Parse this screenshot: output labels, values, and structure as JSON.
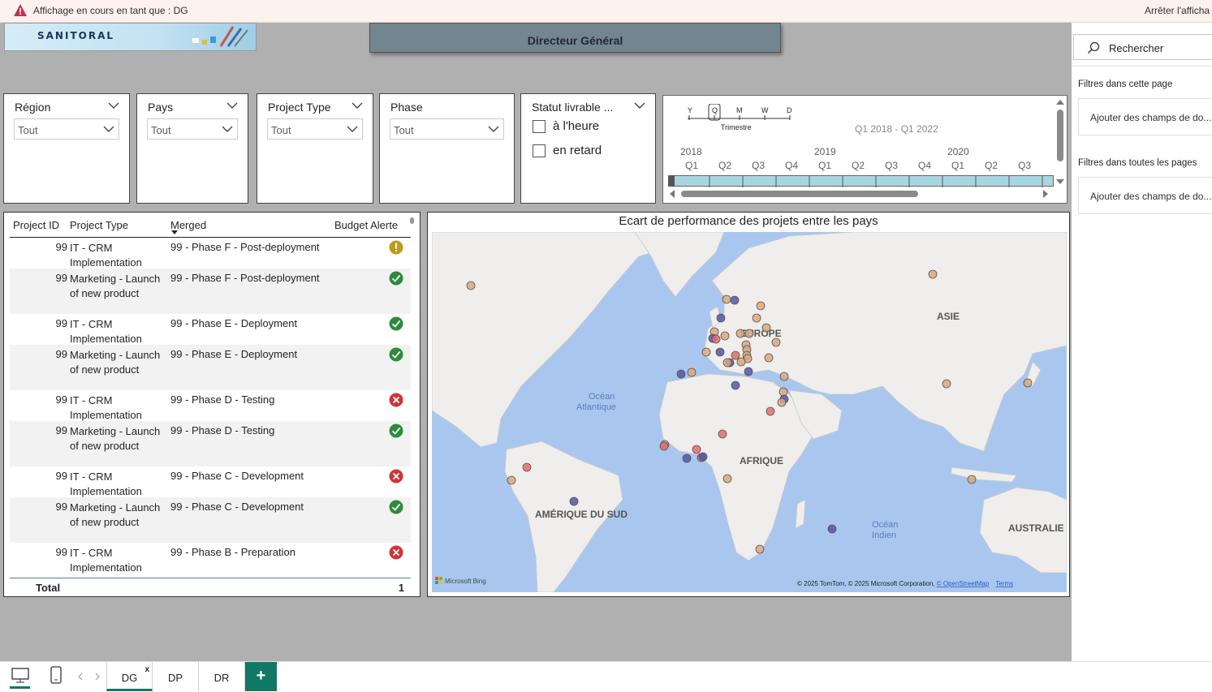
{
  "banner": {
    "viewing_as_text": "Affichage en cours en tant que : DG",
    "stop_text": "Arrêter l'afficha"
  },
  "header": {
    "logo_text": "SANITORAL",
    "title": "Directeur Général"
  },
  "slicers": {
    "region": {
      "label": "Région",
      "value": "Tout"
    },
    "pays": {
      "label": "Pays",
      "value": "Tout"
    },
    "project_type": {
      "label": "Project Type",
      "value": "Tout"
    },
    "phase": {
      "label": "Phase",
      "value": "Tout"
    },
    "statut": {
      "label": "Statut livrable ...",
      "options": [
        "à l'heure",
        "en retard"
      ]
    }
  },
  "time_slicer": {
    "granularity_options": [
      "Y",
      "Q",
      "M",
      "W",
      "D"
    ],
    "granularity_selected": "Q",
    "granularity_label": "Trimestre",
    "range_text": "Q1 2018 - Q1 2022",
    "years": [
      "2018",
      "2019",
      "2020"
    ],
    "quarters": [
      "Q1",
      "Q2",
      "Q3",
      "Q4",
      "Q1",
      "Q2",
      "Q3",
      "Q4",
      "Q1",
      "Q2",
      "Q3"
    ]
  },
  "table": {
    "columns": [
      "Project ID",
      "Project Type",
      "Merged",
      "Budget Alerte"
    ],
    "sorted_column": "Merged",
    "rows": [
      {
        "id": "99",
        "type": "IT - CRM Implementation",
        "merged": "99 - Phase F - Post-deployment",
        "alert": "warning"
      },
      {
        "id": "99",
        "type": "Marketing - Launch of new product",
        "merged": "99 - Phase F - Post-deployment",
        "alert": "ok"
      },
      {
        "id": "99",
        "type": "IT - CRM Implementation",
        "merged": "99 - Phase E - Deployment",
        "alert": "ok"
      },
      {
        "id": "99",
        "type": "Marketing - Launch of new product",
        "merged": "99 - Phase E - Deployment",
        "alert": "ok"
      },
      {
        "id": "99",
        "type": "IT - CRM Implementation",
        "merged": "99 - Phase D - Testing",
        "alert": "error"
      },
      {
        "id": "99",
        "type": "Marketing - Launch of new product",
        "merged": "99 - Phase D - Testing",
        "alert": "ok"
      },
      {
        "id": "99",
        "type": "IT - CRM Implementation",
        "merged": "99 - Phase C - Development",
        "alert": "error"
      },
      {
        "id": "99",
        "type": "Marketing - Launch of new product",
        "merged": "99 - Phase C - Development",
        "alert": "ok"
      },
      {
        "id": "99",
        "type": "IT - CRM Implementation",
        "merged": "99 - Phase B - Preparation",
        "alert": "error"
      }
    ],
    "total_label": "Total",
    "total_value": "1",
    "status_colors": {
      "warning": "#c19a1d",
      "ok": "#2e8b3e",
      "error": "#d13438"
    }
  },
  "map": {
    "title": "Ecart de performance des projets entre les pays",
    "labels": {
      "europe": "EUROPE",
      "asie": "ASIE",
      "afrique": "AFRIQUE",
      "amerique_sud": "AMÉRIQUE DU SUD",
      "australie": "AUSTRALIE",
      "ocean_atl_1": "Océan",
      "ocean_atl_2": "Atlantique",
      "ocean_ind_1": "Océan",
      "ocean_ind_2": "Indien"
    },
    "bing_label": "Microsoft Bing",
    "attribution": "© 2025 TomTom, © 2025 Microsoft Corporation, ",
    "osm_link": "© OpenStreetMap",
    "terms_link": "Terms",
    "colors": {
      "water": "#a9c7ee",
      "land": "#efeeec",
      "tan": "#d9a77c",
      "red": "#e06c6c",
      "blue": "#5553a8"
    }
  },
  "filters_pane": {
    "search_placeholder": "Rechercher",
    "page_section": "Filtres dans cette page",
    "page_add": "Ajouter des champs de do...",
    "all_section": "Filtres dans toutes les pages",
    "all_add": "Ajouter des champs de do..."
  },
  "bottom": {
    "tabs": [
      "DG",
      "DP",
      "DR"
    ],
    "close_symbol": "x",
    "add_symbol": "+"
  }
}
